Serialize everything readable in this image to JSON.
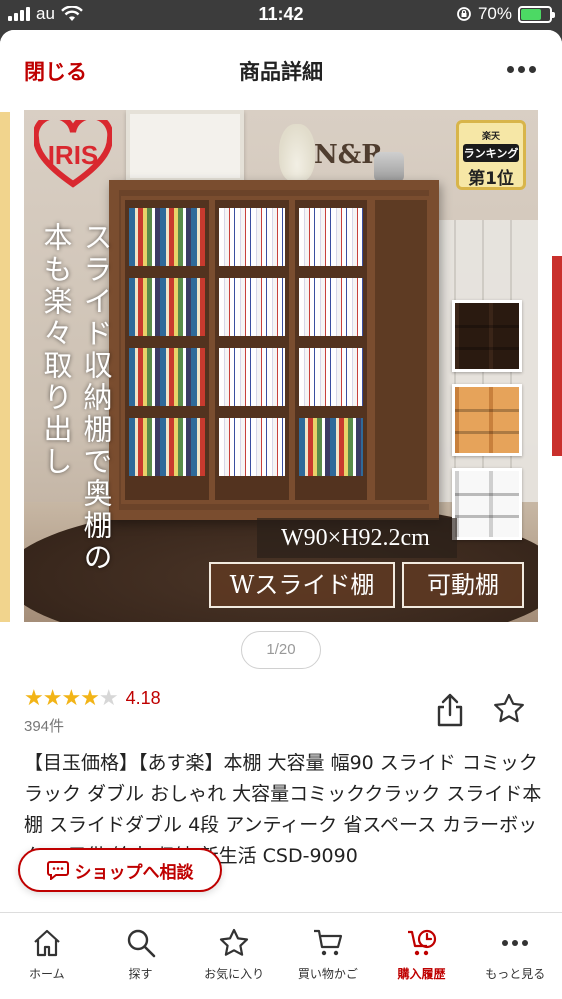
{
  "status": {
    "carrier": "au",
    "time": "11:42",
    "battery": "70%"
  },
  "nav": {
    "close_label": "閉じる",
    "title": "商品詳細"
  },
  "hero": {
    "logo_text": "IRIS",
    "rank_top": "楽天",
    "rank_mid": "ランキング",
    "rank_bottom": "第1位",
    "vertical_text": "スライド収納棚で奥棚の本も楽々取り出し",
    "dims": "W90×H92.2cm",
    "tag1": "Wスライド棚",
    "tag2": "可動棚",
    "brand_sign": "N&R"
  },
  "pager": "1/20",
  "rating": {
    "value": "4.18",
    "stars": 4,
    "count": "394件"
  },
  "product_title": "【目玉価格】【あす楽】本棚 大容量 幅90 スライド コミックラック ダブル おしゃれ 大容量コミッククラック スライド本棚 スライドダブル 4段 アンティーク 省スペース カラーボックス 子供 絵本 収納 新生活 CSD-9090",
  "consult_label": "ショップへ相談",
  "tabs": [
    {
      "label": "ホーム"
    },
    {
      "label": "探す"
    },
    {
      "label": "お気に入り"
    },
    {
      "label": "買い物かご"
    },
    {
      "label": "購入履歴"
    },
    {
      "label": "もっと見る"
    }
  ],
  "colors": {
    "accent": "#bf0000",
    "star": "#f2b417"
  }
}
